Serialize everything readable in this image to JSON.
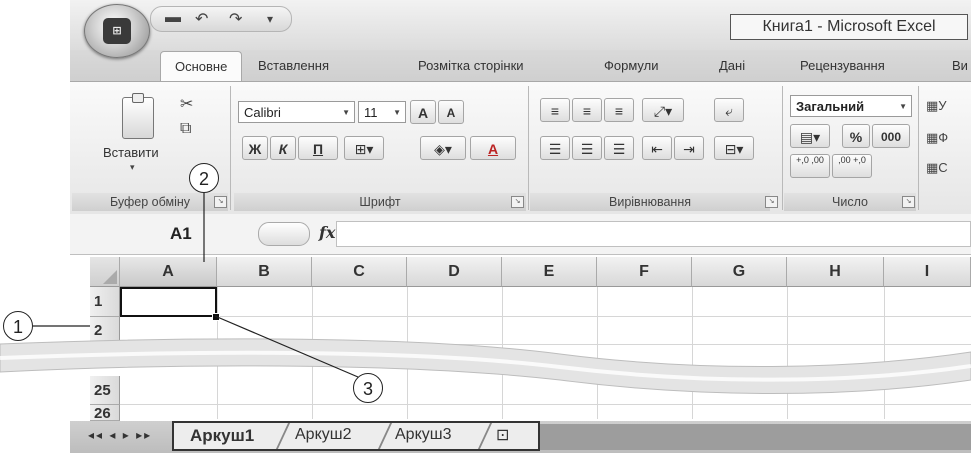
{
  "window": {
    "title": "Книга1 - Microsoft Excel",
    "office_button_label": "",
    "quick_access": [
      "save-icon",
      "undo-icon",
      "redo-icon",
      "customize-icon"
    ]
  },
  "tabs": [
    {
      "label": "Основне",
      "active": true
    },
    {
      "label": "Вставлення",
      "active": false
    },
    {
      "label": "Розмітка сторінки",
      "active": false
    },
    {
      "label": "Формули",
      "active": false
    },
    {
      "label": "Дані",
      "active": false
    },
    {
      "label": "Рецензування",
      "active": false
    },
    {
      "label": "Ви",
      "active": false
    }
  ],
  "ribbon": {
    "clipboard": {
      "label": "Буфер обміну",
      "paste_label": "Вставити"
    },
    "font": {
      "label": "Шрифт",
      "font_name": "Calibri",
      "font_size": "11",
      "bold": "Ж",
      "italic": "К",
      "underline": "П",
      "grow": "A",
      "shrink": "A",
      "font_color": "A"
    },
    "alignment": {
      "label": "Вирівнювання"
    },
    "number": {
      "label": "Число",
      "format": "Загальний",
      "percent": "%",
      "thousands": "000",
      "inc_decimal": "+,0 ,00",
      "dec_decimal": ",00 +,0"
    },
    "styles": {
      "items": [
        "У",
        "Ф",
        "С"
      ]
    }
  },
  "formula_bar": {
    "name_box": "A1",
    "fx_label": "fx",
    "value": ""
  },
  "grid": {
    "columns": [
      "A",
      "B",
      "C",
      "D",
      "E",
      "F",
      "G",
      "H",
      "I"
    ],
    "rows": [
      "1",
      "2",
      "25",
      "26"
    ],
    "active_cell": "A1",
    "selected_column": "A"
  },
  "sheets": {
    "tabs": [
      "Аркуш1",
      "Аркуш2",
      "Аркуш3"
    ],
    "active": "Аркуш1",
    "nav": "◂◂ ◂ ▸ ▸▸"
  },
  "callouts": [
    "1",
    "2",
    "3"
  ]
}
